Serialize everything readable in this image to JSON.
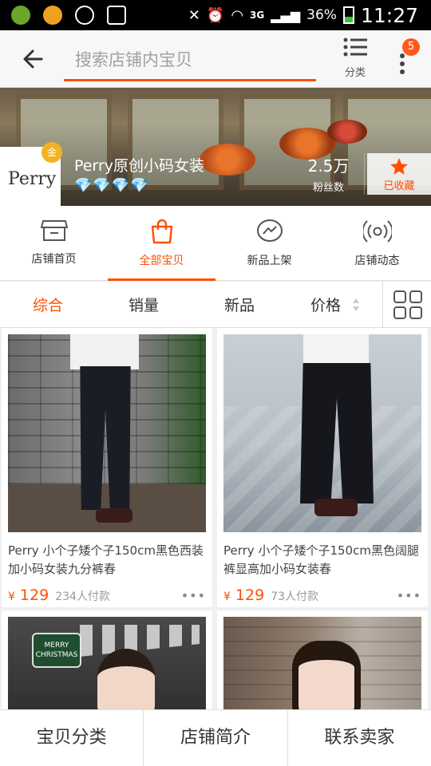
{
  "status_bar": {
    "battery": "36%",
    "network": "3G",
    "time": "11:27"
  },
  "header": {
    "search_placeholder": "搜索店铺内宝贝",
    "category_label": "分类",
    "notification_count": "5"
  },
  "shop": {
    "logo_text": "Perry",
    "medal_text": "金",
    "name": "Perry原创小码女装",
    "rank_diamonds": "💎💎💎💎",
    "fans_count": "2.5万",
    "fans_label": "粉丝数",
    "favorite_label": "已收藏"
  },
  "shop_tabs": [
    {
      "label": "店铺首页"
    },
    {
      "label": "全部宝贝"
    },
    {
      "label": "新品上架"
    },
    {
      "label": "店铺动态"
    }
  ],
  "sort_bar": {
    "options": [
      "综合",
      "销量",
      "新品",
      "价格"
    ],
    "active": "综合"
  },
  "products": [
    {
      "title": "Perry 小个子矮个子150cm黑色西装加小码女装九分裤春",
      "price_symbol": "¥",
      "price": "129",
      "sold": "234人付款",
      "more": "•••"
    },
    {
      "title": "Perry 小个子矮个子150cm黑色阔腿裤显高加小码女装春",
      "price_symbol": "¥",
      "price": "129",
      "sold": "73人付款",
      "more": "•••"
    },
    {
      "title": "",
      "price_symbol": "",
      "price": "",
      "sold": "",
      "more": ""
    },
    {
      "title": "",
      "price_symbol": "",
      "price": "",
      "sold": "",
      "more": ""
    }
  ],
  "product3_sign": "MERRY CHRISTMAS",
  "bottom_bar": [
    "宝贝分类",
    "店铺简介",
    "联系卖家"
  ],
  "colors": {
    "accent": "#ff5000",
    "badge": "#ff5a1f"
  }
}
